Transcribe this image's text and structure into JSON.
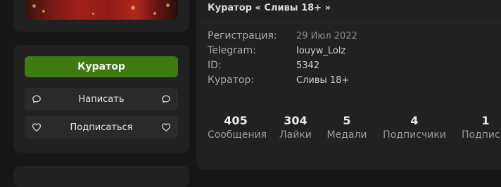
{
  "sidebar": {
    "role_button": "Куратор",
    "write_button": "Написать",
    "follow_button": "Подписаться",
    "icons": {
      "write_left": "chat-bubble-icon",
      "write_right": "chat-bubble-icon",
      "follow_left": "heart-icon",
      "follow_right": "heart-icon"
    },
    "role_color": "#3d7a0f"
  },
  "profile": {
    "headline": "Куратор « Сливы 18+ »",
    "info": [
      {
        "key": "Регистрация:",
        "value": "29 Июл 2022"
      },
      {
        "key": "Telegram:",
        "value": "Iouyw_Lolz"
      },
      {
        "key": "ID:",
        "value": "5342"
      },
      {
        "key": "Куратор:",
        "value": "Сливы 18+"
      }
    ],
    "stats": [
      {
        "num": "405",
        "label": "Сообщения"
      },
      {
        "num": "304",
        "label": "Лайки"
      },
      {
        "num": "5",
        "label": "Медали"
      },
      {
        "num": "4",
        "label": "Подписчики"
      },
      {
        "num": "1",
        "label": "Подписк"
      }
    ]
  }
}
